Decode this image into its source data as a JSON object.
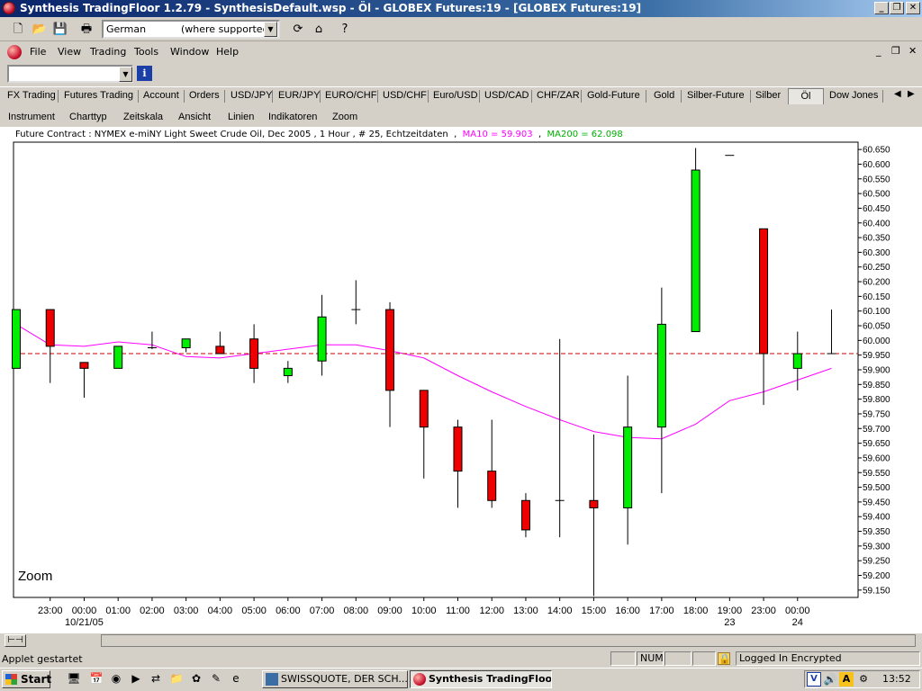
{
  "window": {
    "title": "Synthesis TradingFloor 1.2.79 - SynthesisDefault.wsp - Öl - GLOBEX Futures:19 - [GLOBEX Futures:19]",
    "controls": {
      "minimize": "_",
      "restore": "❐",
      "close": "✕"
    }
  },
  "toolbar": {
    "language_value": "German",
    "language_note": "(where supported)",
    "icons": [
      "new-icon",
      "open-icon",
      "save-icon",
      "print-icon",
      "refresh-icon",
      "home-icon",
      "help-icon"
    ]
  },
  "menubar": {
    "items": [
      "File",
      "View",
      "Trading",
      "Tools",
      "Window",
      "Help"
    ]
  },
  "combo": {
    "info_label": "i",
    "value": ""
  },
  "tabs": {
    "items": [
      "FX Trading",
      "Futures Trading",
      "Account",
      "Orders",
      "USD/JPY",
      "EUR/JPY",
      "EURO/CHF",
      "USD/CHF",
      "Euro/USD",
      "USD/CAD",
      "CHF/ZAR",
      "Gold-Future",
      "Gold",
      "Silber-Future",
      "Silber",
      "Öl",
      "Dow Jones"
    ],
    "active": "Öl"
  },
  "chart_menu": {
    "items": [
      "Instrument",
      "Charttyp",
      "Zeitskala",
      "Ansicht",
      "Linien",
      "Indikatoren",
      "Zoom"
    ]
  },
  "chart_info": {
    "contract": "Future Contract : NYMEX e-miNY Light Sweet Crude Oil, Dec 2005 , 1 Hour , # 25, Echtzeitdaten",
    "ma10": "MA10 = 59.903",
    "ma200": "MA200 = 62.098",
    "zoom_label": "Zoom",
    "colors": {
      "up": "#00ee00",
      "down": "#ee0000",
      "ma10": "#ff00ff",
      "reference": "#cc0000"
    }
  },
  "chart_data": {
    "type": "candlestick",
    "ylim": [
      59.125,
      60.675
    ],
    "y_ticks": [
      "60.650",
      "60.600",
      "60.550",
      "60.500",
      "60.450",
      "60.400",
      "60.350",
      "60.300",
      "60.250",
      "60.200",
      "60.150",
      "60.100",
      "60.050",
      "60.000",
      "59.950",
      "59.900",
      "59.850",
      "59.800",
      "59.750",
      "59.700",
      "59.650",
      "59.600",
      "59.550",
      "59.500",
      "59.450",
      "59.400",
      "59.350",
      "59.300",
      "59.250",
      "59.200",
      "59.150"
    ],
    "x_labels": [
      "23:00",
      "00:00",
      "01:00",
      "02:00",
      "03:00",
      "04:00",
      "05:00",
      "06:00",
      "07:00",
      "08:00",
      "09:00",
      "10:00",
      "11:00",
      "12:00",
      "13:00",
      "14:00",
      "15:00",
      "16:00",
      "17:00",
      "18:00",
      "19:00",
      "23:00",
      "00:00"
    ],
    "date_labels": [
      {
        "under": "00:00",
        "index": 1,
        "text": "10/21/05"
      },
      {
        "under": "19:00",
        "index": 20,
        "text": "23"
      },
      {
        "under": "00:00",
        "index": 22,
        "text": "24"
      }
    ],
    "reference_line": 59.955,
    "candles": [
      {
        "t": "22:00",
        "o": 59.905,
        "h": 60.105,
        "l": 59.905,
        "c": 60.105
      },
      {
        "t": "23:00",
        "o": 60.105,
        "h": 60.105,
        "l": 59.855,
        "c": 59.98
      },
      {
        "t": "00:00",
        "o": 59.925,
        "h": 59.925,
        "l": 59.805,
        "c": 59.905
      },
      {
        "t": "01:00",
        "o": 59.905,
        "h": 59.98,
        "l": 59.905,
        "c": 59.98
      },
      {
        "t": "02:00",
        "o": 59.975,
        "h": 60.03,
        "l": 59.97,
        "c": 59.975
      },
      {
        "t": "03:00",
        "o": 59.975,
        "h": 60.005,
        "l": 59.96,
        "c": 60.005
      },
      {
        "t": "04:00",
        "o": 59.98,
        "h": 60.03,
        "l": 59.96,
        "c": 59.955
      },
      {
        "t": "05:00",
        "o": 60.005,
        "h": 60.055,
        "l": 59.855,
        "c": 59.905
      },
      {
        "t": "06:00",
        "o": 59.88,
        "h": 59.93,
        "l": 59.855,
        "c": 59.905
      },
      {
        "t": "07:00",
        "o": 59.93,
        "h": 60.155,
        "l": 59.88,
        "c": 60.08
      },
      {
        "t": "08:00",
        "o": 60.105,
        "h": 60.205,
        "l": 60.055,
        "c": 60.105
      },
      {
        "t": "09:00",
        "o": 60.105,
        "h": 60.13,
        "l": 59.705,
        "c": 59.83
      },
      {
        "t": "10:00",
        "o": 59.83,
        "h": 59.83,
        "l": 59.53,
        "c": 59.705
      },
      {
        "t": "11:00",
        "o": 59.705,
        "h": 59.73,
        "l": 59.43,
        "c": 59.555
      },
      {
        "t": "12:00",
        "o": 59.555,
        "h": 59.73,
        "l": 59.43,
        "c": 59.455
      },
      {
        "t": "13:00",
        "o": 59.455,
        "h": 59.48,
        "l": 59.33,
        "c": 59.355
      },
      {
        "t": "14:00",
        "o": 59.455,
        "h": 60.005,
        "l": 59.33,
        "c": 59.455
      },
      {
        "t": "15:00",
        "o": 59.455,
        "h": 59.68,
        "l": 59.13,
        "c": 59.43
      },
      {
        "t": "16:00",
        "o": 59.43,
        "h": 59.88,
        "l": 59.305,
        "c": 59.705
      },
      {
        "t": "17:00",
        "o": 59.705,
        "h": 60.18,
        "l": 59.48,
        "c": 60.055
      },
      {
        "t": "18:00",
        "o": 60.03,
        "h": 60.655,
        "l": 60.03,
        "c": 60.58
      },
      {
        "t": "19:00",
        "o": 60.63,
        "h": 60.63,
        "l": 60.63,
        "c": 60.63
      },
      {
        "t": "23:00",
        "o": 60.38,
        "h": 60.38,
        "l": 59.78,
        "c": 59.955
      },
      {
        "t": "00:00",
        "o": 59.905,
        "h": 60.03,
        "l": 59.83,
        "c": 59.955
      },
      {
        "t": "01:00",
        "o": 59.955,
        "h": 60.105,
        "l": 59.955,
        "c": 59.955
      }
    ],
    "ma10": [
      60.055,
      59.985,
      59.98,
      59.995,
      59.985,
      59.945,
      59.94,
      59.955,
      59.97,
      59.985,
      59.985,
      59.965,
      59.94,
      59.88,
      59.825,
      59.775,
      59.73,
      59.69,
      59.67,
      59.665,
      59.715,
      59.795,
      59.825,
      59.865,
      59.905
    ],
    "grid": false
  },
  "status": {
    "message": "Applet gestartet",
    "num": "NUM",
    "secure": "Logged In Encrypted"
  },
  "taskbar": {
    "start": "Start",
    "tasks": [
      {
        "label": "SWISSQUOTE, DER SCH...",
        "active": false
      },
      {
        "label": "Synthesis TradingFloo...",
        "active": true
      }
    ],
    "clock": "13:52"
  }
}
